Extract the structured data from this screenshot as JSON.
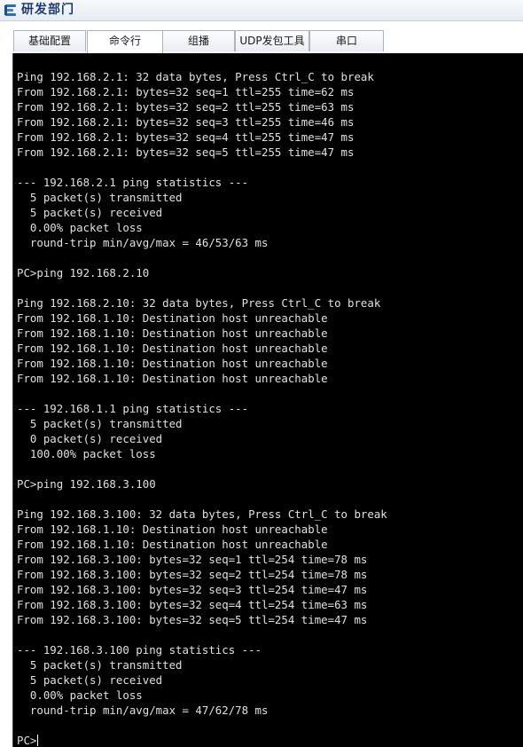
{
  "window": {
    "title": "研发部门"
  },
  "tabs": [
    {
      "label": "基础配置",
      "active": false
    },
    {
      "label": "命令行",
      "active": true
    },
    {
      "label": "组播",
      "active": false
    },
    {
      "label": "UDP发包工具",
      "active": false
    },
    {
      "label": "串口",
      "active": false
    }
  ],
  "terminal": {
    "lines": [
      "Ping 192.168.2.1: 32 data bytes, Press Ctrl_C to break",
      "From 192.168.2.1: bytes=32 seq=1 ttl=255 time=62 ms",
      "From 192.168.2.1: bytes=32 seq=2 ttl=255 time=63 ms",
      "From 192.168.2.1: bytes=32 seq=3 ttl=255 time=46 ms",
      "From 192.168.2.1: bytes=32 seq=4 ttl=255 time=47 ms",
      "From 192.168.2.1: bytes=32 seq=5 ttl=255 time=47 ms",
      "",
      "--- 192.168.2.1 ping statistics ---",
      "  5 packet(s) transmitted",
      "  5 packet(s) received",
      "  0.00% packet loss",
      "  round-trip min/avg/max = 46/53/63 ms",
      "",
      "PC>ping 192.168.2.10",
      "",
      "Ping 192.168.2.10: 32 data bytes, Press Ctrl_C to break",
      "From 192.168.1.10: Destination host unreachable",
      "From 192.168.1.10: Destination host unreachable",
      "From 192.168.1.10: Destination host unreachable",
      "From 192.168.1.10: Destination host unreachable",
      "From 192.168.1.10: Destination host unreachable",
      "",
      "--- 192.168.1.1 ping statistics ---",
      "  5 packet(s) transmitted",
      "  0 packet(s) received",
      "  100.00% packet loss",
      "",
      "PC>ping 192.168.3.100",
      "",
      "Ping 192.168.3.100: 32 data bytes, Press Ctrl_C to break",
      "From 192.168.1.10: Destination host unreachable",
      "From 192.168.1.10: Destination host unreachable",
      "From 192.168.3.100: bytes=32 seq=1 ttl=254 time=78 ms",
      "From 192.168.3.100: bytes=32 seq=2 ttl=254 time=78 ms",
      "From 192.168.3.100: bytes=32 seq=3 ttl=254 time=47 ms",
      "From 192.168.3.100: bytes=32 seq=4 ttl=254 time=63 ms",
      "From 192.168.3.100: bytes=32 seq=5 ttl=254 time=47 ms",
      "",
      "--- 192.168.3.100 ping statistics ---",
      "  5 packet(s) transmitted",
      "  5 packet(s) received",
      "  0.00% packet loss",
      "  round-trip min/avg/max = 47/62/78 ms",
      ""
    ],
    "prompt": "PC>"
  }
}
